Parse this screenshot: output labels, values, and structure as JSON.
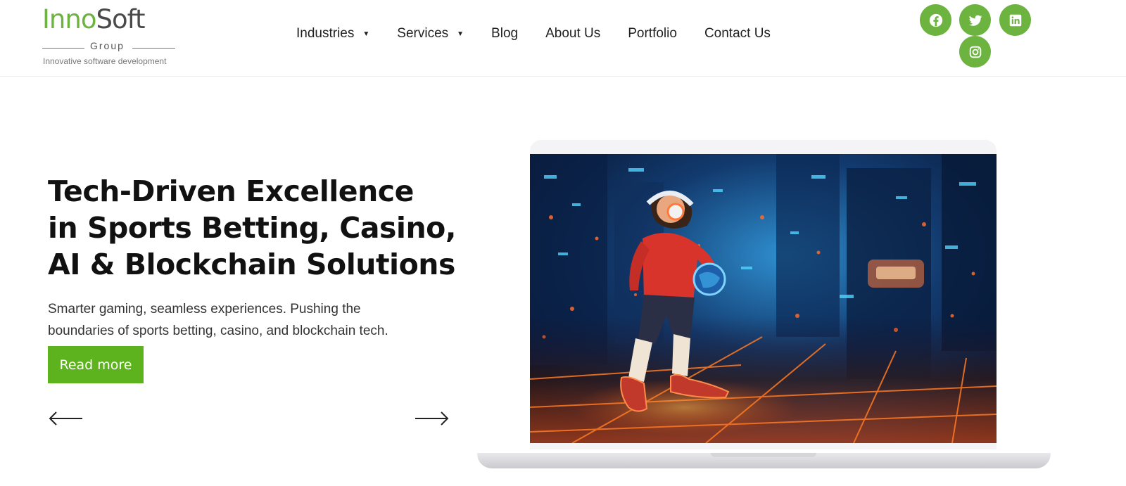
{
  "brand": {
    "name_part1": "Inno",
    "name_part2": "Soft",
    "group": "Group",
    "tagline": "Innovative software development"
  },
  "nav": {
    "items": [
      {
        "label": "Industries",
        "has_dropdown": true
      },
      {
        "label": "Services",
        "has_dropdown": true
      },
      {
        "label": "Blog",
        "has_dropdown": false
      },
      {
        "label": "About Us",
        "has_dropdown": false
      },
      {
        "label": "Portfolio",
        "has_dropdown": false
      },
      {
        "label": "Contact Us",
        "has_dropdown": false
      }
    ],
    "caret": "▼"
  },
  "social": [
    {
      "name": "facebook-icon"
    },
    {
      "name": "twitter-icon"
    },
    {
      "name": "linkedin-icon"
    },
    {
      "name": "instagram-icon"
    }
  ],
  "hero": {
    "title_lines": [
      "Tech-Driven Excellence",
      "in Sports Betting, Casino,",
      "AI & Blockchain Solutions"
    ],
    "subtitle_lines": [
      "Smarter gaming, seamless experiences. Pushing the",
      "boundaries of sports betting, casino, and blockchain tech."
    ],
    "cta_label": "Read more",
    "prev_icon": "arrow-left-icon",
    "next_icon": "arrow-right-icon"
  },
  "colors": {
    "brand_green": "#6cb33f",
    "cta_green": "#5db31d",
    "text_dark": "#111111"
  }
}
